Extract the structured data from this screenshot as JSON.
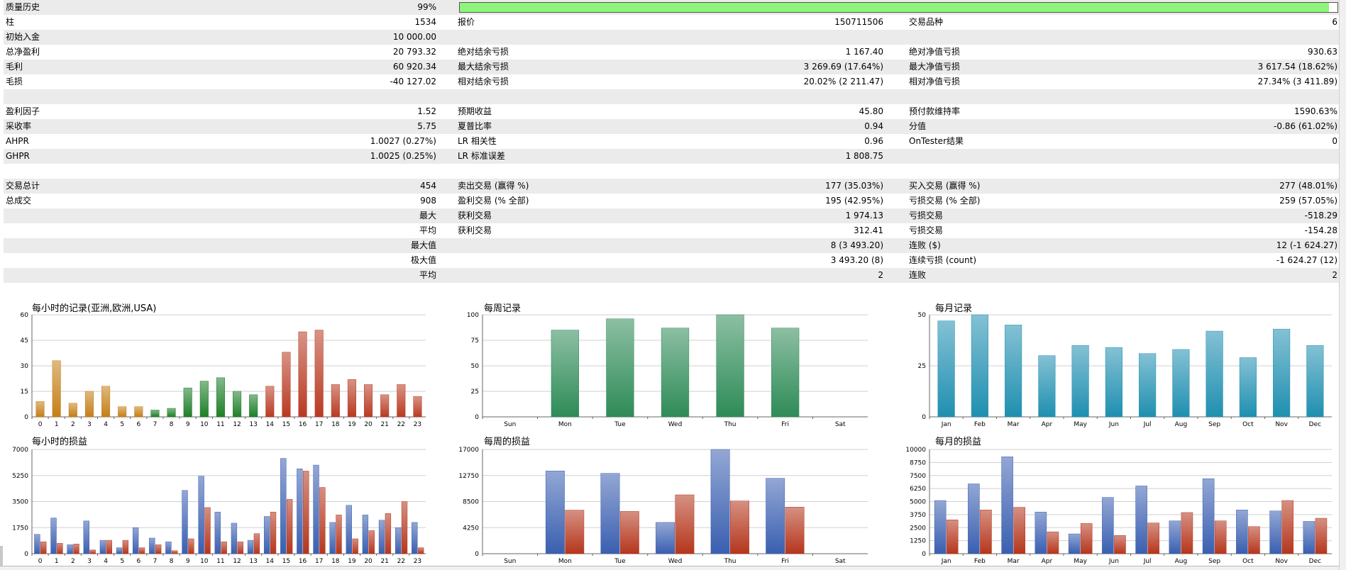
{
  "stats": {
    "rows": [
      {
        "c0": "质量历史",
        "c1": "99%",
        "c2": "",
        "c3": "",
        "c4": "",
        "c5": ""
      },
      {
        "c0": "柱",
        "c1": "1534",
        "c2": "报价",
        "c3": "150711506",
        "c4": "交易品种",
        "c5": "6"
      },
      {
        "c0": "初始入金",
        "c1": "10 000.00",
        "c2": "",
        "c3": "",
        "c4": "",
        "c5": ""
      },
      {
        "c0": "总净盈利",
        "c1": "20 793.32",
        "c2": "绝对结余亏损",
        "c3": "1 167.40",
        "c4": "绝对净值亏损",
        "c5": "930.63"
      },
      {
        "c0": "毛利",
        "c1": "60 920.34",
        "c2": "最大结余亏损",
        "c3": "3 269.69 (17.64%)",
        "c4": "最大净值亏损",
        "c5": "3 617.54 (18.62%)"
      },
      {
        "c0": "毛损",
        "c1": "-40 127.02",
        "c2": "相对结余亏损",
        "c3": "20.02% (2 211.47)",
        "c4": "相对净值亏损",
        "c5": "27.34% (3 411.89)"
      },
      {
        "c0": "",
        "c1": "",
        "c2": "",
        "c3": "",
        "c4": "",
        "c5": ""
      },
      {
        "c0": "盈利因子",
        "c1": "1.52",
        "c2": "预期收益",
        "c3": "45.80",
        "c4": "预付款维持率",
        "c5": "1590.63%"
      },
      {
        "c0": "采收率",
        "c1": "5.75",
        "c2": "夏普比率",
        "c3": "0.94",
        "c4": "分值",
        "c5": "-0.86 (61.02%)"
      },
      {
        "c0": "AHPR",
        "c1": "1.0027 (0.27%)",
        "c2": "LR 相关性",
        "c3": "0.96",
        "c4": "OnTester结果",
        "c5": "0"
      },
      {
        "c0": "GHPR",
        "c1": "1.0025 (0.25%)",
        "c2": "LR 标准误差",
        "c3": "1 808.75",
        "c4": "",
        "c5": ""
      },
      {
        "c0": "",
        "c1": "",
        "c2": "",
        "c3": "",
        "c4": "",
        "c5": ""
      },
      {
        "c0": "交易总计",
        "c1": "454",
        "c2": "卖出交易 (赢得 %)",
        "c3": "177 (35.03%)",
        "c4": "买入交易 (赢得 %)",
        "c5": "277 (48.01%)"
      },
      {
        "c0": "总成交",
        "c1": "908",
        "c2": "盈利交易 (% 全部)",
        "c3": "195 (42.95%)",
        "c4": "亏损交易 (% 全部)",
        "c5": "259 (57.05%)"
      },
      {
        "c0": "",
        "c1": "最大",
        "c2": "获利交易",
        "c3": "1 974.13",
        "c4": "亏损交易",
        "c5": "-518.29"
      },
      {
        "c0": "",
        "c1": "平均",
        "c2": "获利交易",
        "c3": "312.41",
        "c4": "亏损交易",
        "c5": "-154.28"
      },
      {
        "c0": "",
        "c1": "最大值",
        "c2": "",
        "c3": "8 (3 493.20)",
        "c4": "连败 ($)",
        "c5": "12 (-1 624.27)"
      },
      {
        "c0": "",
        "c1": "极大值",
        "c2": "",
        "c3": "3 493.20 (8)",
        "c4": "连续亏损 (count)",
        "c5": "-1 624.27 (12)"
      },
      {
        "c0": "",
        "c1": "平均",
        "c2": "",
        "c3": "2",
        "c4": "连败",
        "c5": "2"
      },
      {
        "c0": "",
        "c1": "",
        "c2": "",
        "c3": "",
        "c4": "",
        "c5": ""
      }
    ],
    "quality_progress": 0.99
  },
  "charts": {
    "hourly_records": {
      "title": "每小时的记录(亚洲,欧洲,USA)",
      "type": "bar",
      "categories": [
        "0",
        "1",
        "2",
        "3",
        "4",
        "5",
        "6",
        "7",
        "8",
        "9",
        "10",
        "11",
        "12",
        "13",
        "14",
        "15",
        "16",
        "17",
        "18",
        "19",
        "20",
        "21",
        "22",
        "23"
      ],
      "values": [
        9,
        33,
        8,
        15,
        18,
        6,
        6,
        4,
        5,
        17,
        21,
        23,
        15,
        13,
        18,
        38,
        50,
        51,
        19,
        22,
        19,
        13,
        19,
        12
      ],
      "colors": [
        "#c47f17",
        "#c47f17",
        "#c47f17",
        "#c47f17",
        "#c47f17",
        "#c47f17",
        "#c47f17",
        "#1d7f28",
        "#1d7f28",
        "#1d7f28",
        "#1d7f28",
        "#1d7f28",
        "#1d7f28",
        "#1d7f28",
        "#b83a22",
        "#b83a22",
        "#b83a22",
        "#b83a22",
        "#b83a22",
        "#b83a22",
        "#b83a22",
        "#b83a22",
        "#b83a22",
        "#b83a22"
      ],
      "yticks": [
        "0",
        "15",
        "30",
        "45",
        "60"
      ],
      "ymax": 60
    },
    "weekly_records": {
      "title": "每周记录",
      "type": "bar",
      "categories": [
        "Sun",
        "Mon",
        "Tue",
        "Wed",
        "Thu",
        "Fri",
        "Sat"
      ],
      "values": [
        0,
        85,
        96,
        87,
        100,
        87,
        0
      ],
      "color": "#2e8b57",
      "yticks": [
        "0",
        "25",
        "50",
        "75",
        "100"
      ],
      "ymax": 100
    },
    "monthly_records": {
      "title": "每月记录",
      "type": "bar",
      "categories": [
        "Jan",
        "Feb",
        "Mar",
        "Apr",
        "May",
        "Jun",
        "Jul",
        "Aug",
        "Sep",
        "Oct",
        "Nov",
        "Dec"
      ],
      "values": [
        47,
        50,
        45,
        30,
        35,
        34,
        31,
        33,
        42,
        29,
        43,
        35
      ],
      "color": "#1f8fb0",
      "yticks": [
        "0",
        "25",
        "50"
      ],
      "ymax": 50
    },
    "hourly_pnl": {
      "title": "每小时的损益",
      "type": "bar",
      "categories": [
        "0",
        "1",
        "2",
        "3",
        "4",
        "5",
        "6",
        "7",
        "8",
        "9",
        "10",
        "11",
        "12",
        "13",
        "14",
        "15",
        "16",
        "17",
        "18",
        "19",
        "20",
        "21",
        "22",
        "23"
      ],
      "series": [
        {
          "values": [
            1300,
            2400,
            600,
            2200,
            900,
            400,
            1750,
            1050,
            800,
            4250,
            5200,
            2800,
            2050,
            900,
            2500,
            6400,
            5700,
            5950,
            2100,
            3250,
            2600,
            2250,
            1750,
            2100
          ]
        },
        {
          "values": [
            800,
            700,
            650,
            250,
            900,
            900,
            400,
            600,
            200,
            1000,
            3100,
            800,
            800,
            1350,
            2800,
            3650,
            5550,
            4450,
            2600,
            1000,
            1550,
            2700,
            3500,
            400
          ]
        }
      ],
      "series_colors": [
        "#3a5fb0",
        "#b5361c"
      ],
      "yticks": [
        "0",
        "1750",
        "3500",
        "5250",
        "7000"
      ],
      "ymax": 7000
    },
    "weekly_pnl": {
      "title": "每周的损益",
      "type": "bar",
      "categories": [
        "Sun",
        "Mon",
        "Tue",
        "Wed",
        "Thu",
        "Fri",
        "Sat"
      ],
      "series": [
        {
          "values": [
            0,
            13500,
            13100,
            5100,
            17000,
            12300,
            0
          ]
        },
        {
          "values": [
            0,
            7100,
            6900,
            9600,
            8600,
            7600,
            0
          ]
        }
      ],
      "series_colors": [
        "#3a5fb0",
        "#b5361c"
      ],
      "yticks": [
        "0",
        "4250",
        "8500",
        "12750",
        "17000"
      ],
      "ymax": 17000
    },
    "monthly_pnl": {
      "title": "每月的损益",
      "type": "bar",
      "categories": [
        "Jan",
        "Feb",
        "Mar",
        "Apr",
        "May",
        "Jun",
        "Jul",
        "Aug",
        "Sep",
        "Oct",
        "Nov",
        "Dec"
      ],
      "series": [
        {
          "values": [
            5100,
            6700,
            9300,
            4000,
            1900,
            5400,
            6500,
            3150,
            7200,
            4200,
            4100,
            3100
          ]
        },
        {
          "values": [
            3250,
            4200,
            4450,
            2100,
            2900,
            1750,
            2950,
            3950,
            3150,
            2600,
            5100,
            3400
          ]
        }
      ],
      "series_colors": [
        "#3a5fb0",
        "#b5361c"
      ],
      "yticks": [
        "0",
        "1250",
        "2500",
        "3750",
        "5000",
        "6250",
        "7500",
        "8750",
        "10000"
      ],
      "ymax": 10000
    }
  },
  "chart_data": [
    {
      "type": "bar",
      "title": "每小时的记录(亚洲,欧洲,USA)",
      "categories": [
        "0",
        "1",
        "2",
        "3",
        "4",
        "5",
        "6",
        "7",
        "8",
        "9",
        "10",
        "11",
        "12",
        "13",
        "14",
        "15",
        "16",
        "17",
        "18",
        "19",
        "20",
        "21",
        "22",
        "23"
      ],
      "values": [
        9,
        33,
        8,
        15,
        18,
        6,
        6,
        4,
        5,
        17,
        21,
        23,
        15,
        13,
        18,
        38,
        50,
        51,
        19,
        22,
        19,
        13,
        19,
        12
      ],
      "ylim": [
        0,
        60
      ]
    },
    {
      "type": "bar",
      "title": "每周记录",
      "categories": [
        "Sun",
        "Mon",
        "Tue",
        "Wed",
        "Thu",
        "Fri",
        "Sat"
      ],
      "values": [
        0,
        85,
        96,
        87,
        100,
        87,
        0
      ],
      "ylim": [
        0,
        100
      ]
    },
    {
      "type": "bar",
      "title": "每月记录",
      "categories": [
        "Jan",
        "Feb",
        "Mar",
        "Apr",
        "May",
        "Jun",
        "Jul",
        "Aug",
        "Sep",
        "Oct",
        "Nov",
        "Dec"
      ],
      "values": [
        47,
        50,
        45,
        30,
        35,
        34,
        31,
        33,
        42,
        29,
        43,
        35
      ],
      "ylim": [
        0,
        50
      ]
    },
    {
      "type": "bar",
      "title": "每小时的损益",
      "categories": [
        "0",
        "1",
        "2",
        "3",
        "4",
        "5",
        "6",
        "7",
        "8",
        "9",
        "10",
        "11",
        "12",
        "13",
        "14",
        "15",
        "16",
        "17",
        "18",
        "19",
        "20",
        "21",
        "22",
        "23"
      ],
      "series": [
        {
          "values": [
            1300,
            2400,
            600,
            2200,
            900,
            400,
            1750,
            1050,
            800,
            4250,
            5200,
            2800,
            2050,
            900,
            2500,
            6400,
            5700,
            5950,
            2100,
            3250,
            2600,
            2250,
            1750,
            2100
          ]
        },
        {
          "values": [
            800,
            700,
            650,
            250,
            900,
            900,
            400,
            600,
            200,
            1000,
            3100,
            800,
            800,
            1350,
            2800,
            3650,
            5550,
            4450,
            2600,
            1000,
            1550,
            2700,
            3500,
            400
          ]
        }
      ],
      "ylim": [
        0,
        7000
      ]
    },
    {
      "type": "bar",
      "title": "每周的损益",
      "categories": [
        "Sun",
        "Mon",
        "Tue",
        "Wed",
        "Thu",
        "Fri",
        "Sat"
      ],
      "series": [
        {
          "values": [
            0,
            13500,
            13100,
            5100,
            17000,
            12300,
            0
          ]
        },
        {
          "values": [
            0,
            7100,
            6900,
            9600,
            8600,
            7600,
            0
          ]
        }
      ],
      "ylim": [
        0,
        17000
      ]
    },
    {
      "type": "bar",
      "title": "每月的损益",
      "categories": [
        "Jan",
        "Feb",
        "Mar",
        "Apr",
        "May",
        "Jun",
        "Jul",
        "Aug",
        "Sep",
        "Oct",
        "Nov",
        "Dec"
      ],
      "series": [
        {
          "values": [
            5100,
            6700,
            9300,
            4000,
            1900,
            5400,
            6500,
            3150,
            7200,
            4200,
            4100,
            3100
          ]
        },
        {
          "values": [
            3250,
            4200,
            4450,
            2100,
            2900,
            1750,
            2950,
            3950,
            3150,
            2600,
            5100,
            3400
          ]
        }
      ],
      "ylim": [
        0,
        10000
      ]
    }
  ]
}
